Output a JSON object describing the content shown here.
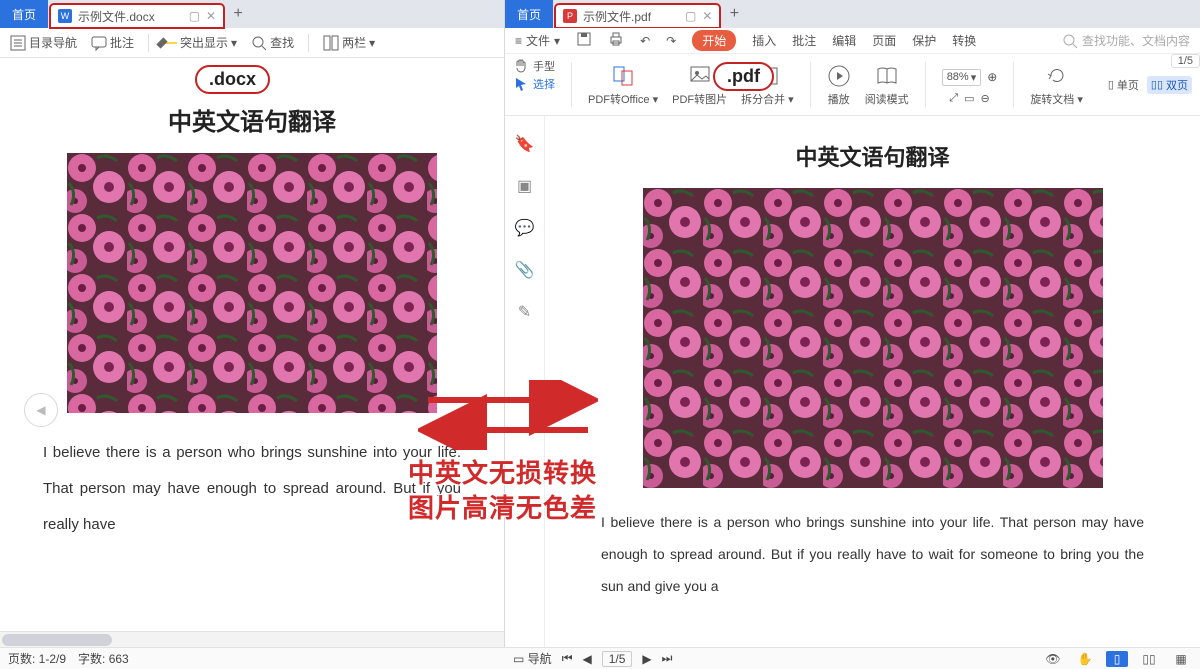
{
  "left": {
    "tab_home": "首页",
    "tab_filename": "示例文件.docx",
    "toolbar": {
      "outline": "目录导航",
      "comment": "批注",
      "highlight": "突出显示",
      "find": "查找",
      "twocol": "两栏"
    },
    "badge": ".docx",
    "doc_title": "中英文语句翻译",
    "doc_text": "I believe there is a person who brings sunshine into your life. That person may have enough to spread around. But if you really have",
    "status_pages": "页数: 1-2/9",
    "status_words": "字数: 663"
  },
  "right": {
    "tab_home": "首页",
    "tab_filename": "示例文件.pdf",
    "menubar": {
      "file": "文件",
      "start": "开始",
      "insert": "插入",
      "annotate": "批注",
      "edit": "编辑",
      "page": "页面",
      "protect": "保护",
      "convert": "转换",
      "search_placeholder": "查找功能、文档内容"
    },
    "ribbon": {
      "hand": "手型",
      "select": "选择",
      "pdf2office": "PDF转Office",
      "pdf2img": "PDF转图片",
      "splitmerge": "拆分合并",
      "play": "播放",
      "readmode": "阅读模式",
      "zoom": "88%",
      "rotatedoc": "旋转文档",
      "singlepage": "单页",
      "doublepage": "双页",
      "page_indicator": "1/5"
    },
    "badge": ".pdf",
    "doc_title": "中英文语句翻译",
    "doc_text": "I believe there is a person who brings sunshine into your life. That person may have enough to spread around. But if you really have to wait for someone to bring you the sun and give you a",
    "status_nav": "导航",
    "status_page": "1/5"
  },
  "annotation": {
    "line1": "中英文无损转换",
    "line2": "图片高清无色差"
  }
}
